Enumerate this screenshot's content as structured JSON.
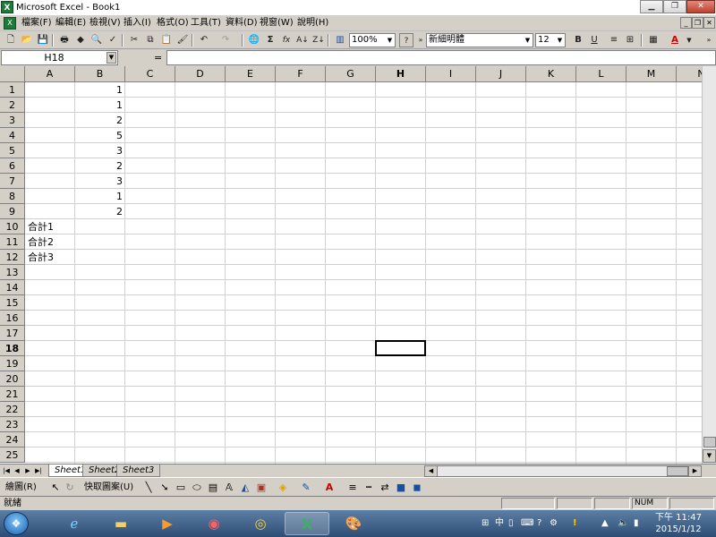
{
  "window": {
    "title": "Microsoft Excel - Book1",
    "app_icon_text": "X"
  },
  "menu": {
    "items": [
      "檔案(F)",
      "編輯(E)",
      "檢視(V)",
      "插入(I)",
      "格式(O)",
      "工具(T)",
      "資料(D)",
      "視窗(W)",
      "說明(H)"
    ]
  },
  "toolbar": {
    "zoom": "100%",
    "font_name": "新細明體",
    "font_size": "12",
    "bold_label": "B",
    "underline_label": "U",
    "sigma_label": "Σ",
    "fx_label": "fx"
  },
  "formula_bar": {
    "name_box": "H18",
    "equals": "=",
    "content": ""
  },
  "sheet": {
    "columns": [
      "A",
      "B",
      "C",
      "D",
      "E",
      "F",
      "G",
      "H",
      "I",
      "J",
      "K",
      "L",
      "M",
      "N"
    ],
    "rows": [
      "1",
      "2",
      "3",
      "4",
      "5",
      "6",
      "7",
      "8",
      "9",
      "10",
      "11",
      "12",
      "13",
      "14",
      "15",
      "16",
      "17",
      "18",
      "19",
      "20",
      "21",
      "22",
      "23",
      "24",
      "25"
    ],
    "active_column": "H",
    "active_row": "18",
    "column_b_values": [
      "1",
      "1",
      "2",
      "5",
      "3",
      "2",
      "3",
      "1",
      "2"
    ],
    "column_a_labels": [
      "合計1",
      "合計2",
      "合計3"
    ]
  },
  "sheet_tabs": [
    "Sheet1",
    "Sheet2",
    "Sheet3"
  ],
  "draw_toolbar": {
    "draw_label": "繪圖(R)",
    "autoshapes_label": "快取圖案(U)"
  },
  "status_bar": {
    "text": "就緒",
    "num_indicator": "NUM"
  },
  "taskbar": {
    "ime": "中",
    "time": "下午 11:47",
    "date": "2015/1/12"
  },
  "colors": {
    "chrome": "#d4d0c8",
    "excel_green": "#1f7a3a",
    "taskbar": "#2e4d74"
  }
}
